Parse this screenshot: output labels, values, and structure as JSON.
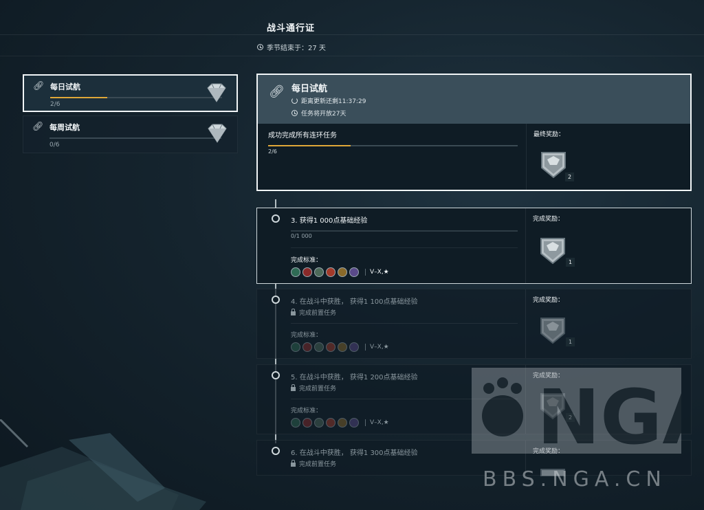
{
  "header": {
    "title": "战斗通行证",
    "season_text": "季节结束于：27 天"
  },
  "quest_list": [
    {
      "name": "每日试航",
      "progress_text": "2/6",
      "progress": 0.33,
      "active": true
    },
    {
      "name": "每周试航",
      "progress_text": "0/6",
      "progress": 0.0,
      "active": false
    }
  ],
  "detail": {
    "title": "每日试航",
    "refresh_text": "距离更新还剩11:37:29",
    "open_text": "任务将开放27天",
    "description": "成功完成所有连环任务",
    "progress_text": "2/6",
    "progress": 0.33,
    "reward_label": "最终奖励：",
    "reward_count": "2"
  },
  "tasks": [
    {
      "title": "3.  获得1 000点基础经验",
      "progress_text": "0/1  000",
      "criteria_label": "完成标准：",
      "criteria_text": "V–X,★",
      "reward_label": "完成奖励：",
      "reward_count": "1",
      "locked": false
    },
    {
      "title": "4.  在战斗中获胜，  获得1 100点基础经验",
      "lock_text": "完成前置任务",
      "criteria_label": "完成标准：",
      "criteria_text": "V–X,★",
      "reward_label": "完成奖励：",
      "reward_count": "1",
      "locked": true
    },
    {
      "title": "5.  在战斗中获胜，  获得1 200点基础经验",
      "lock_text": "完成前置任务",
      "criteria_label": "完成标准：",
      "criteria_text": "V–X,★",
      "reward_label": "完成奖励：",
      "reward_count": "2",
      "locked": true
    },
    {
      "title": "6.  在战斗中获胜，  获得1 300点基础经验",
      "lock_text": "完成前置任务",
      "reward_label": "完成奖励：",
      "locked": true
    }
  ],
  "criteria_icons": [
    {
      "name": "nation-icon-1",
      "color": "#2f6b55"
    },
    {
      "name": "nation-icon-2",
      "color": "#8a2a2a"
    },
    {
      "name": "nation-icon-3",
      "color": "#4d6a5a"
    },
    {
      "name": "nation-icon-4",
      "color": "#a33a2a"
    },
    {
      "name": "nation-icon-5",
      "color": "#8a6a2a"
    },
    {
      "name": "nation-icon-6",
      "color": "#5a4a8a"
    }
  ],
  "watermark": {
    "logo_text": "NGA",
    "url": "BBS.NGA.CN"
  },
  "colors": {
    "progress_fill": "#e0a838",
    "active_border": "#f2f6f8",
    "header_bg": "#3a4e5a"
  }
}
